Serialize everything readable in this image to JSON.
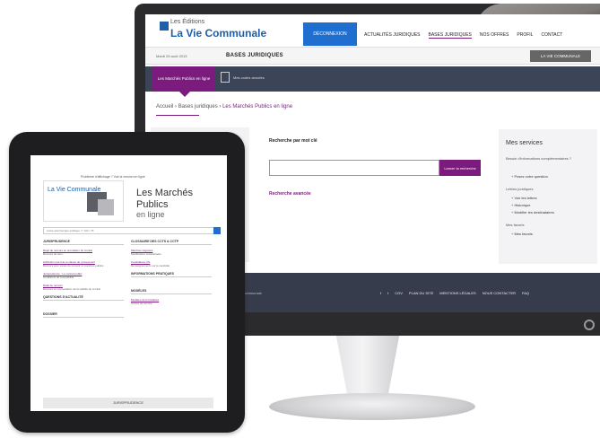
{
  "desktop": {
    "logo": {
      "small": "Les Éditions",
      "big": "La Vie Communale"
    },
    "deconnexion_label": "DÉCONNEXION",
    "nav": [
      "ACTUALITÉS JURIDIQUES",
      "BASES JURIDIQUES",
      "NOS OFFRES",
      "PROFIL",
      "CONTACT"
    ],
    "subbar": {
      "date": "Mardi 25 août 2015",
      "title": "BASES JURIDIQUES",
      "account_label": "LA VIE COMMUNALE"
    },
    "tabs": {
      "active": "Les Marchés Publics en ligne",
      "second": "Mes codes annotés"
    },
    "breadcrumb": {
      "home": "Accueil",
      "sep1": " › ",
      "bases": "Bases juridiques",
      "sep2": " › ",
      "current": "Les Marchés Publics en ligne"
    },
    "search": {
      "label": "Recherche par mot clé",
      "button": "Lancer la recherche",
      "advanced": "Recherche avancée"
    },
    "services": {
      "title": "Mes services",
      "need_info": "Besoin d'informations complémentaires ?",
      "ask": "Posez votre question",
      "letters": "Lettres juridiques",
      "sub": "Voir les lettres",
      "history": "Historique",
      "modify": "Modifier les destinataires",
      "favorites_hdr": "Mes favoris",
      "favorites": "Mes favoris"
    },
    "footer": {
      "left": "La Vie Communale",
      "links": [
        "CGV",
        "PLAN DU SITE",
        "MENTIONS LÉGALES",
        "NOUS CONTACTER",
        "FAQ"
      ]
    }
  },
  "tablet": {
    "notice": "Problème d'affichage ? Voir la version en ligne",
    "brand": "La Vie Communale",
    "title_1": "Les Marchés Publics",
    "title_2": "en ligne",
    "search_line": "Lettre électronique juridique n° 104 / 15",
    "left_col": {
      "sections": [
        "JURISPRUDENCE",
        "QUESTIONS D'ACTUALITÉ",
        "DOSSIER"
      ],
      "items": [
        {
          "title": "Rejet du recours en annulation du contrat",
          "desc": "Recours de tiers"
        },
        {
          "title": "Attribution par lots et clause de groupement",
          "desc": "Recours pour excès de pouvoir et marchés publics"
        },
        {
          "title": "Jurisprudence : Le contrat public",
          "desc": "Conditions de recevabilité"
        },
        {
          "title": "Délai de recours",
          "desc": "Recours en contestation de la validité du contrat"
        }
      ]
    },
    "right_col": {
      "sections": [
        "CLOSSAIRE DES CCTS & CCTP",
        "INFORMATIONS PRATIQUES",
        "MODÈLES"
      ],
      "items": [
        {
          "title": "Marchés négociés",
          "desc": "Modification substantielle"
        },
        {
          "title": "Candidature CE",
          "desc": "Renseignements sur le candidat"
        },
        {
          "title": "Modèles de formulaires",
          "desc": "Ordres de service"
        }
      ]
    },
    "footer": "JURISPRUDENCE"
  }
}
